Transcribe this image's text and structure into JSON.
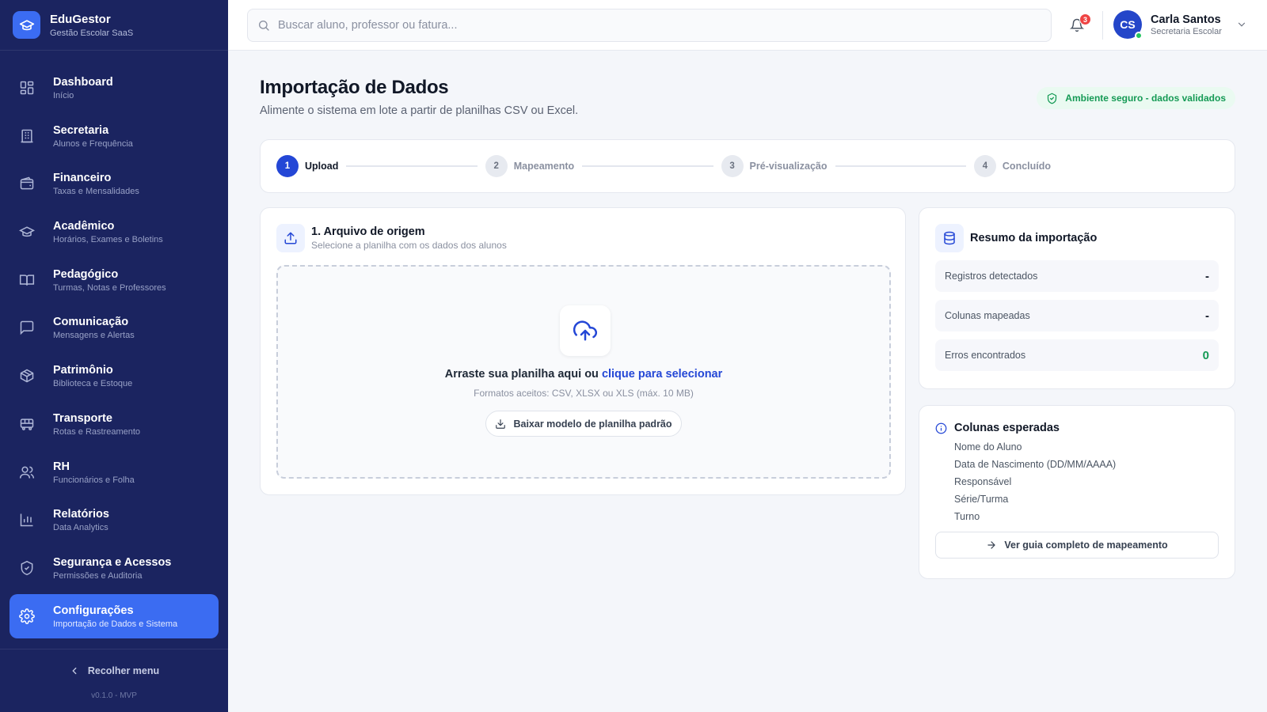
{
  "app": {
    "name": "EduGestor",
    "tagline": "Gestão Escolar SaaS"
  },
  "sidebar": {
    "items": [
      {
        "label": "Dashboard",
        "sub": "Início",
        "icon": "grid-icon"
      },
      {
        "label": "Secretaria",
        "sub": "Alunos e Frequência",
        "icon": "building-icon"
      },
      {
        "label": "Financeiro",
        "sub": "Taxas e Mensalidades",
        "icon": "wallet-icon"
      },
      {
        "label": "Acadêmico",
        "sub": "Horários, Exames e Boletins",
        "icon": "graduation-cap-icon"
      },
      {
        "label": "Pedagógico",
        "sub": "Turmas, Notas e Professores",
        "icon": "book-icon"
      },
      {
        "label": "Comunicação",
        "sub": "Mensagens e Alertas",
        "icon": "chat-icon"
      },
      {
        "label": "Patrimônio",
        "sub": "Biblioteca e Estoque",
        "icon": "box-icon"
      },
      {
        "label": "Transporte",
        "sub": "Rotas e Rastreamento",
        "icon": "bus-icon"
      },
      {
        "label": "RH",
        "sub": "Funcionários e Folha",
        "icon": "users-icon"
      },
      {
        "label": "Relatórios",
        "sub": "Data Analytics",
        "icon": "bar-chart-icon"
      },
      {
        "label": "Segurança e Acessos",
        "sub": "Permissões e Auditoria",
        "icon": "shield-icon"
      },
      {
        "label": "Configurações",
        "sub": "Importação de Dados e Sistema",
        "icon": "gear-icon",
        "active": true
      }
    ],
    "collapse_label": "Recolher menu",
    "version": "v0.1.0 - MVP"
  },
  "header": {
    "search_placeholder": "Buscar aluno, professor ou fatura...",
    "notifications_count": "3",
    "user": {
      "initials": "CS",
      "name": "Carla Santos",
      "role": "Secretaria Escolar"
    }
  },
  "page": {
    "title": "Importação de Dados",
    "subtitle": "Alimente o sistema em lote a partir de planilhas CSV ou Excel.",
    "secure_badge": "Ambiente seguro - dados validados"
  },
  "stepper": {
    "steps": [
      {
        "num": "1",
        "label": "Upload",
        "active": true
      },
      {
        "num": "2",
        "label": "Mapeamento"
      },
      {
        "num": "3",
        "label": "Pré-visualização"
      },
      {
        "num": "4",
        "label": "Concluído"
      }
    ]
  },
  "upload": {
    "title": "1. Arquivo de origem",
    "subtitle": "Selecione a planilha com os dados dos alunos",
    "drop_text": "Arraste sua planilha aqui ou",
    "drop_link": "clique para selecionar",
    "formats": "Formatos aceitos: CSV, XLSX ou XLS (máx. 10 MB)",
    "template_button": "Baixar modelo de planilha padrão"
  },
  "summary": {
    "title": "Resumo da importação",
    "rows": [
      {
        "label": "Registros detectados",
        "value": "-"
      },
      {
        "label": "Colunas mapeadas",
        "value": "-"
      },
      {
        "label": "Erros encontrados",
        "value": "0"
      }
    ]
  },
  "columns": {
    "title": "Colunas esperadas",
    "items": [
      "Nome do Aluno",
      "Data de Nascimento (DD/MM/AAAA)",
      "Responsável",
      "Série/Turma",
      "Turno"
    ],
    "guide_button": "Ver guia completo de mapeamento"
  },
  "colors": {
    "sidebar_bg": "#1b2460",
    "accent": "#3b6cf2",
    "primary": "#2447d6",
    "success": "#159a55",
    "badge": "#ef4444"
  }
}
